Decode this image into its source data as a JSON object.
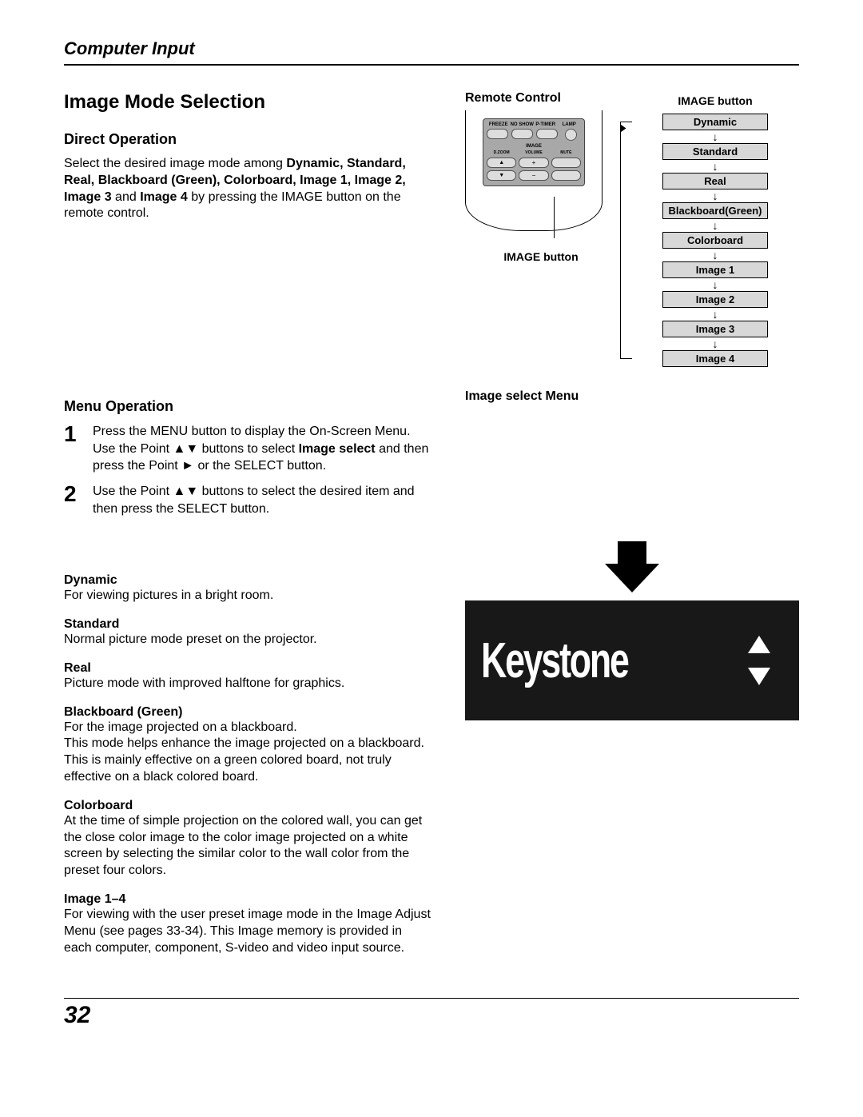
{
  "header": {
    "title": "Computer Input"
  },
  "section": {
    "title": "Image Mode Selection"
  },
  "direct": {
    "heading": "Direct Operation",
    "intro_pre": "Select the desired image mode among ",
    "modes_bold": "Dynamic, Standard, Real, Blackboard (Green), Colorboard, Image 1, Image 2, Image 3",
    "intro_mid": " and ",
    "last_bold": "Image 4",
    "intro_post": " by pressing the IMAGE button on the remote control."
  },
  "menu": {
    "heading": "Menu Operation",
    "step1_num": "1",
    "step1_a": "Press the MENU button to display the On-Screen Menu. Use the Point ▲▼ buttons to select ",
    "step1_b": "Image select",
    "step1_c": " and then press the Point ► or the SELECT button.",
    "step2_num": "2",
    "step2": "Use the Point ▲▼ buttons to select  the desired item and then press the SELECT button."
  },
  "modes": [
    {
      "name": "Dynamic",
      "desc": "For viewing pictures in a bright room."
    },
    {
      "name": "Standard",
      "desc": "Normal picture mode preset on the projector."
    },
    {
      "name": "Real",
      "desc": "Picture mode with improved halftone for graphics."
    },
    {
      "name": "Blackboard (Green)",
      "desc": "For the image projected on a blackboard.\nThis mode helps enhance the image projected on a blackboard. This is mainly effective on a green colored board, not truly effective on a black colored board."
    },
    {
      "name": "Colorboard",
      "desc": "At the time of simple projection on the colored wall, you can get the close color image to the color image projected on a white screen by selecting the similar color to the wall color from the preset four colors."
    },
    {
      "name": "Image 1–4",
      "desc": "For viewing with the user preset image mode in the Image Adjust Menu (see pages 33-34). This Image memory is provided in each computer, component, S-video and video input source."
    }
  ],
  "remote": {
    "title": "Remote Control",
    "caption": "IMAGE button",
    "top_labels": [
      "FREEZE",
      "NO SHOW",
      "P-TIMER",
      "LAMP"
    ],
    "image_label": "IMAGE",
    "bottom_labels": [
      "D.ZOOM",
      "VOLUME",
      "MUTE"
    ]
  },
  "flow": {
    "caption": "IMAGE button",
    "items": [
      "Dynamic",
      "Standard",
      "Real",
      "Blackboard(Green)",
      "Colorboard",
      "Image 1",
      "Image 2",
      "Image 3",
      "Image 4"
    ]
  },
  "image_select_menu": {
    "title": "Image select Menu"
  },
  "keystone": {
    "label": "Keystone"
  },
  "page_number": "32"
}
